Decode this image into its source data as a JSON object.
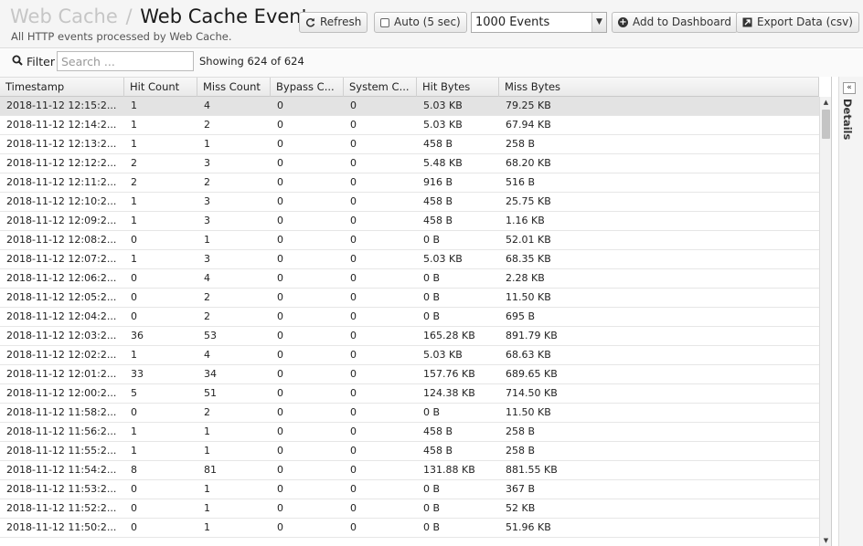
{
  "header": {
    "breadcrumb_parent": "Web Cache",
    "breadcrumb_sep": "/",
    "title": "Web Cache Events",
    "subtitle": "All HTTP events processed by Web Cache."
  },
  "toolbar": {
    "refresh_label": "Refresh",
    "auto_label": "Auto (5 sec)",
    "events_select_value": "1000 Events",
    "add_dashboard_label": "Add to Dashboard",
    "export_label": "Export Data (csv)"
  },
  "filter": {
    "label": "Filter",
    "placeholder": "Search ...",
    "showing": "Showing 624 of 624"
  },
  "table": {
    "columns": [
      "Timestamp",
      "Hit Count",
      "Miss Count",
      "Bypass C...",
      "System C...",
      "Hit Bytes",
      "Miss Bytes"
    ],
    "rows": [
      [
        "2018-11-12 12:15:2...",
        "1",
        "4",
        "0",
        "0",
        "5.03 KB",
        "79.25 KB"
      ],
      [
        "2018-11-12 12:14:2...",
        "1",
        "2",
        "0",
        "0",
        "5.03 KB",
        "67.94 KB"
      ],
      [
        "2018-11-12 12:13:2...",
        "1",
        "1",
        "0",
        "0",
        "458 B",
        "258 B"
      ],
      [
        "2018-11-12 12:12:2...",
        "2",
        "3",
        "0",
        "0",
        "5.48 KB",
        "68.20 KB"
      ],
      [
        "2018-11-12 12:11:2...",
        "2",
        "2",
        "0",
        "0",
        "916 B",
        "516 B"
      ],
      [
        "2018-11-12 12:10:2...",
        "1",
        "3",
        "0",
        "0",
        "458 B",
        "25.75 KB"
      ],
      [
        "2018-11-12 12:09:2...",
        "1",
        "3",
        "0",
        "0",
        "458 B",
        "1.16 KB"
      ],
      [
        "2018-11-12 12:08:2...",
        "0",
        "1",
        "0",
        "0",
        "0 B",
        "52.01 KB"
      ],
      [
        "2018-11-12 12:07:2...",
        "1",
        "3",
        "0",
        "0",
        "5.03 KB",
        "68.35 KB"
      ],
      [
        "2018-11-12 12:06:2...",
        "0",
        "4",
        "0",
        "0",
        "0 B",
        "2.28 KB"
      ],
      [
        "2018-11-12 12:05:2...",
        "0",
        "2",
        "0",
        "0",
        "0 B",
        "11.50 KB"
      ],
      [
        "2018-11-12 12:04:2...",
        "0",
        "2",
        "0",
        "0",
        "0 B",
        "695 B"
      ],
      [
        "2018-11-12 12:03:2...",
        "36",
        "53",
        "0",
        "0",
        "165.28 KB",
        "891.79 KB"
      ],
      [
        "2018-11-12 12:02:2...",
        "1",
        "4",
        "0",
        "0",
        "5.03 KB",
        "68.63 KB"
      ],
      [
        "2018-11-12 12:01:2...",
        "33",
        "34",
        "0",
        "0",
        "157.76 KB",
        "689.65 KB"
      ],
      [
        "2018-11-12 12:00:2...",
        "5",
        "51",
        "0",
        "0",
        "124.38 KB",
        "714.50 KB"
      ],
      [
        "2018-11-12 11:58:2...",
        "0",
        "2",
        "0",
        "0",
        "0 B",
        "11.50 KB"
      ],
      [
        "2018-11-12 11:56:2...",
        "1",
        "1",
        "0",
        "0",
        "458 B",
        "258 B"
      ],
      [
        "2018-11-12 11:55:2...",
        "1",
        "1",
        "0",
        "0",
        "458 B",
        "258 B"
      ],
      [
        "2018-11-12 11:54:2...",
        "8",
        "81",
        "0",
        "0",
        "131.88 KB",
        "881.55 KB"
      ],
      [
        "2018-11-12 11:53:2...",
        "0",
        "1",
        "0",
        "0",
        "0 B",
        "367 B"
      ],
      [
        "2018-11-12 11:52:2...",
        "0",
        "1",
        "0",
        "0",
        "0 B",
        "52 KB"
      ],
      [
        "2018-11-12 11:50:2...",
        "0",
        "1",
        "0",
        "0",
        "0 B",
        "51.96 KB"
      ]
    ]
  },
  "details": {
    "label": "Details",
    "collapse_icon": "double-chevron-left-icon"
  },
  "icons": {
    "refresh": "refresh-icon",
    "auto": "checkbox-icon",
    "add": "plus-circle-icon",
    "export": "export-icon",
    "filter": "search-icon"
  }
}
